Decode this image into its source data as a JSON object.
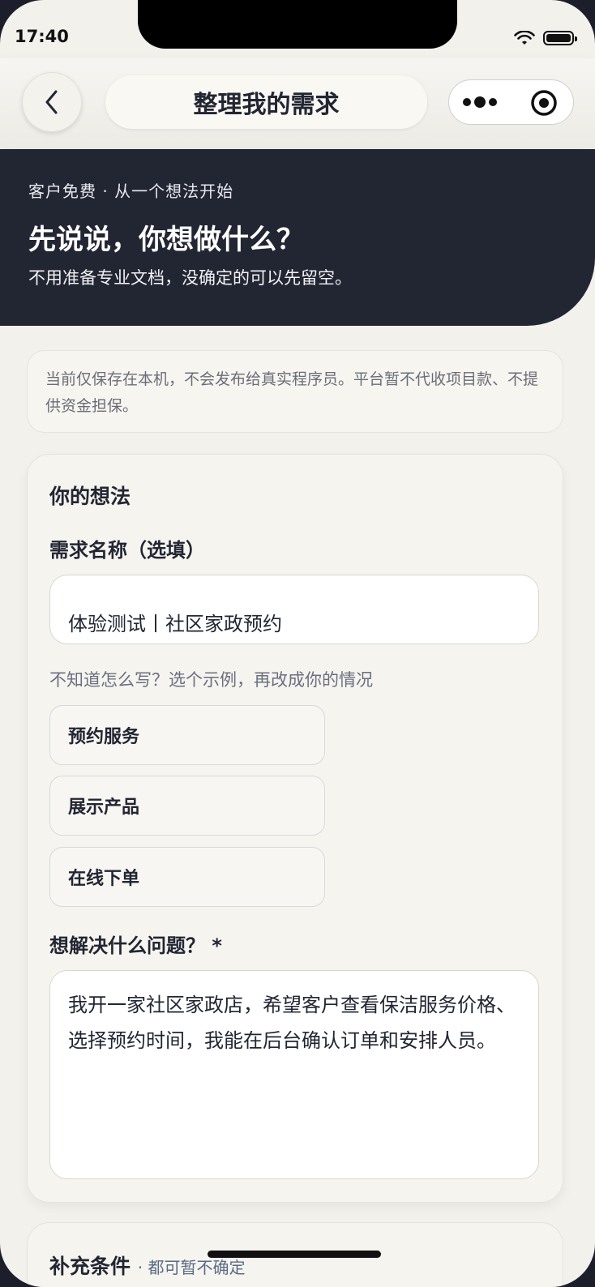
{
  "status_bar": {
    "time": "17:40"
  },
  "navbar": {
    "title": "整理我的需求"
  },
  "hero": {
    "eyebrow": "客户免费 · 从一个想法开始",
    "title": "先说说，你想做什么？",
    "subtitle": "不用准备专业文档，没确定的可以先留空。"
  },
  "notice": {
    "text": "当前仅保存在本机，不会发布给真实程序员。平台暂不代收项目款、不提供资金担保。"
  },
  "idea_card": {
    "title": "你的想法",
    "name_label": "需求名称（选填）",
    "name_value": "体验测试丨社区家政预约",
    "hint": "不知道怎么写？选个示例，再改成你的情况",
    "examples": [
      "预约服务",
      "展示产品",
      "在线下单"
    ],
    "problem_label": "想解决什么问题？ *",
    "problem_value": "我开一家社区家政店，希望客户查看保洁服务价格、选择预约时间，我能在后台确认订单和安排人员。"
  },
  "extra_card": {
    "title": "补充条件",
    "subtitle": "· 都可暂不确定"
  },
  "icons": {
    "back": "chevron-left-icon",
    "more": "more-dots-icon",
    "record": "record-icon",
    "wifi": "wifi-icon",
    "battery": "battery-icon"
  }
}
